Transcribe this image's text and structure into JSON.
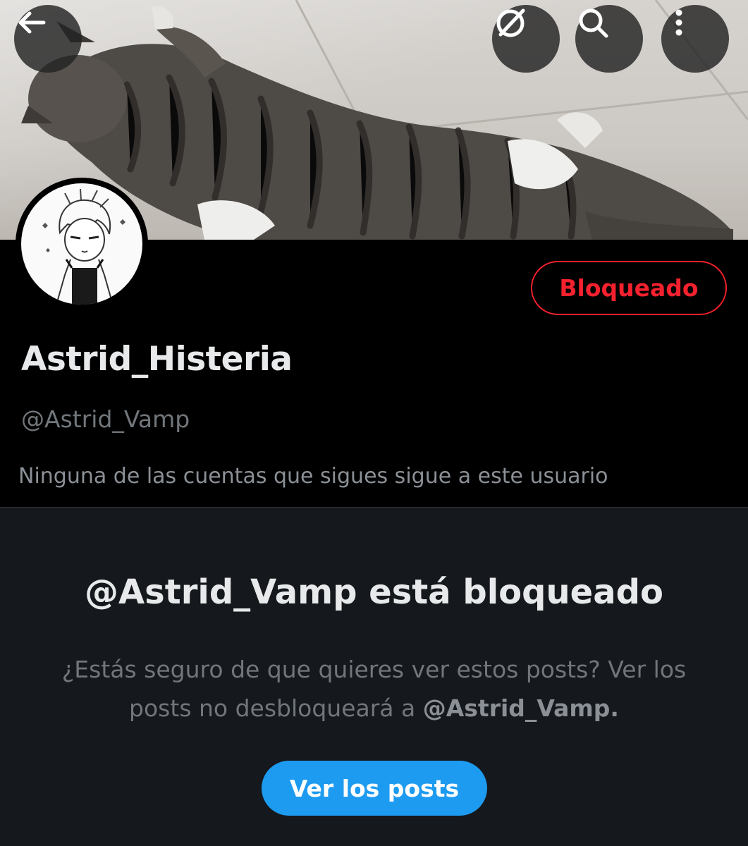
{
  "topbar": {
    "back_icon": "arrow-left-icon",
    "grok_icon": "grok-icon",
    "search_icon": "search-icon",
    "more_icon": "more-vertical-icon"
  },
  "profile": {
    "display_name": "Astrid_Histeria",
    "handle": "@Astrid_Vamp",
    "blocked_label": "Bloqueado",
    "followers_note": "Ninguna de las cuentas que sigues sigue a este usuario"
  },
  "notice": {
    "title": "@Astrid_Vamp está bloqueado",
    "body_text": "¿Estás seguro de que quieres ver estos posts? Ver los posts no desbloqueará a ",
    "body_handle": "@Astrid_Vamp.",
    "button_label": "Ver los posts"
  },
  "colors": {
    "background": "#15181c",
    "header": "#000000",
    "blocked_red": "#f4212e",
    "accent_blue": "#1d9bf0"
  }
}
